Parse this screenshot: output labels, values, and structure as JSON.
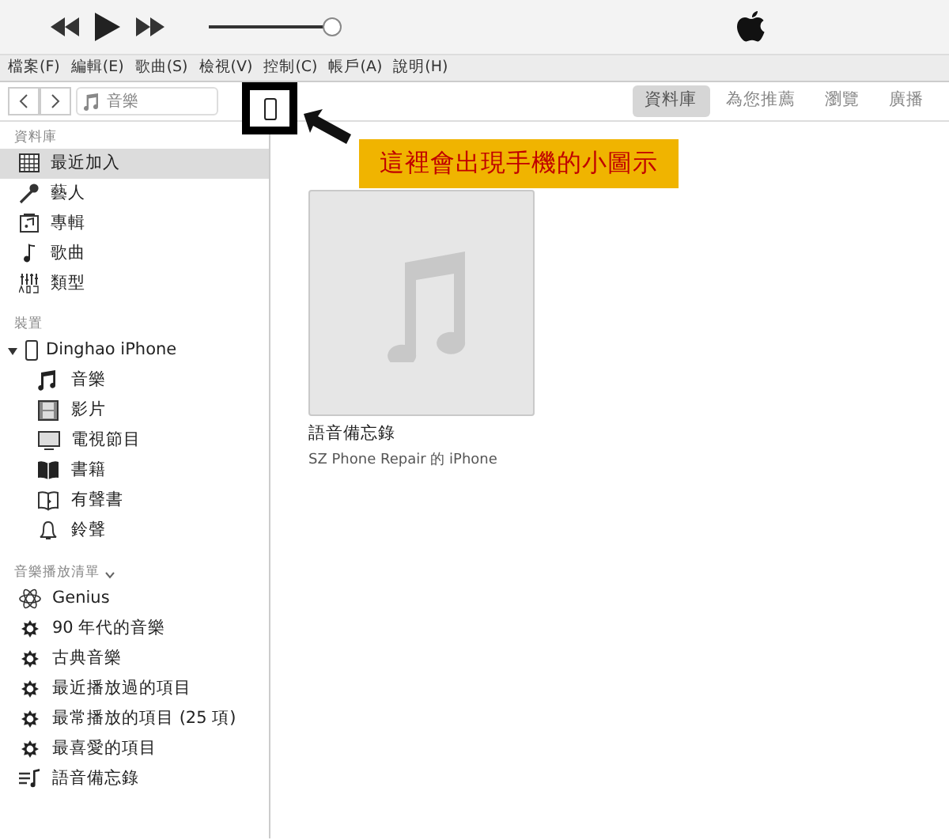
{
  "player": {
    "volume": {
      "level": 0.97
    }
  },
  "menu_bar": [
    "檔案(F)",
    "編輯(E)",
    "歌曲(S)",
    "檢視(V)",
    "控制(C)",
    "帳戶(A)",
    "說明(H)"
  ],
  "nav": {
    "media_picker": "音樂"
  },
  "tabs": [
    {
      "label": "資料庫",
      "selected": true
    },
    {
      "label": "為您推薦",
      "selected": false
    },
    {
      "label": "瀏覽",
      "selected": false
    },
    {
      "label": "廣播",
      "selected": false
    }
  ],
  "sidebar": {
    "library": {
      "heading": "資料庫",
      "items": [
        {
          "label": "最近加入",
          "selected": true
        },
        {
          "label": "藝人",
          "selected": false
        },
        {
          "label": "專輯",
          "selected": false
        },
        {
          "label": "歌曲",
          "selected": false
        },
        {
          "label": "類型",
          "selected": false
        }
      ]
    },
    "devices": {
      "heading": "裝置",
      "device": {
        "name": "Dinghao  iPhone",
        "expanded": true,
        "children": [
          {
            "label": "音樂"
          },
          {
            "label": "影片"
          },
          {
            "label": "電視節目"
          },
          {
            "label": "書籍"
          },
          {
            "label": "有聲書"
          },
          {
            "label": "鈴聲"
          }
        ]
      }
    },
    "playlists": {
      "heading": "音樂播放清單",
      "items": [
        {
          "label": "Genius"
        },
        {
          "label": "90 年代的音樂"
        },
        {
          "label": "古典音樂"
        },
        {
          "label": "最近播放過的項目"
        },
        {
          "label": "最常播放的項目 (25 項)"
        },
        {
          "label": "最喜愛的項目"
        },
        {
          "label": "語音備忘錄"
        }
      ]
    }
  },
  "albums": [
    {
      "title": "語音備忘錄",
      "subtitle": "SZ Phone Repair 的 iPhone"
    }
  ],
  "annotation": {
    "text": "這裡會出現手機的小圖示"
  }
}
